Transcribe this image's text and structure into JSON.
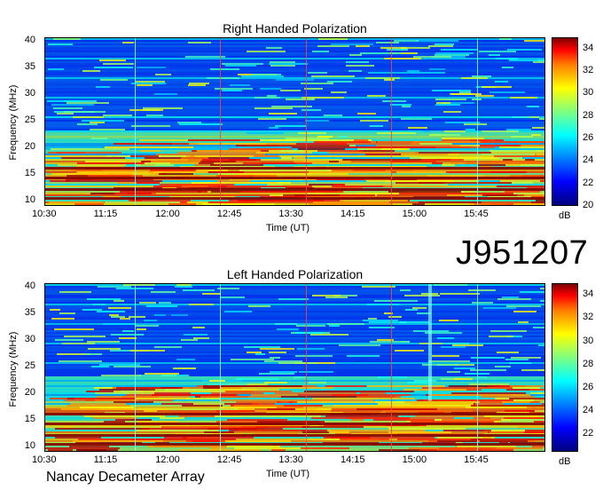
{
  "chart_data": [
    {
      "type": "heatmap",
      "title": "Right Handed Polarization",
      "xlabel": "Time (UT)",
      "ylabel": "Frequency (MHz)",
      "x_ticks": [
        "10:30",
        "11:15",
        "12:00",
        "12:45",
        "13:30",
        "14:15",
        "15:00",
        "15:45"
      ],
      "y_ticks": [
        10,
        15,
        20,
        25,
        30,
        35,
        40
      ],
      "ylim": [
        10,
        40
      ],
      "colorbar": {
        "label": "dB",
        "ticks": [
          20,
          22,
          24,
          26,
          28,
          30,
          32,
          34
        ],
        "range": [
          20,
          35
        ]
      },
      "colormap": "jet"
    },
    {
      "type": "heatmap",
      "title": "Left Handed Polarization",
      "xlabel": "Time (UT)",
      "ylabel": "Frequency (MHz)",
      "x_ticks": [
        "10:30",
        "11:15",
        "12:00",
        "12:45",
        "13:30",
        "14:15",
        "15:00",
        "15:45"
      ],
      "y_ticks": [
        10,
        15,
        20,
        25,
        30,
        35,
        40
      ],
      "ylim": [
        10,
        40
      ],
      "colorbar": {
        "label": "dB",
        "ticks": [
          22,
          24,
          26,
          28,
          30,
          32,
          34
        ],
        "range": [
          20.5,
          35
        ]
      },
      "colormap": "jet"
    }
  ],
  "identifier": "J951207",
  "footer": "Nancay Decameter Array",
  "colors": {
    "background": "#00007f",
    "mid": "#00ffff",
    "high": "#7f0000"
  }
}
